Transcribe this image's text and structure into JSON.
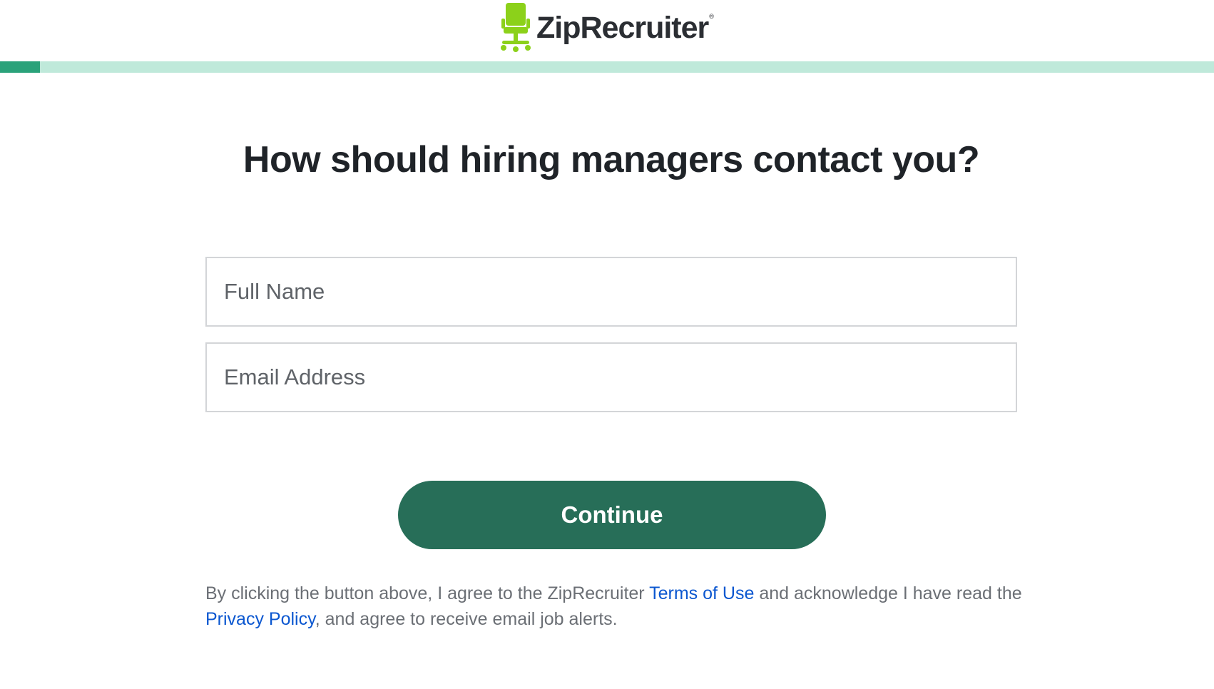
{
  "brand": {
    "name": "ZipRecruiter",
    "registered_mark": "®",
    "logo_icon": "chair-icon",
    "logo_color": "#8cd11a",
    "text_color": "#2b2e33"
  },
  "progress": {
    "fraction": 0.033,
    "fill_color": "#2aa27a",
    "track_color": "#bfe9da"
  },
  "page": {
    "heading": "How should hiring managers contact you?"
  },
  "form": {
    "full_name": {
      "placeholder": "Full Name",
      "value": ""
    },
    "email": {
      "placeholder": "Email Address",
      "value": ""
    },
    "continue_label": "Continue",
    "button_color": "#276e58"
  },
  "legal": {
    "part1": "By clicking the button above, I agree to the ZipRecruiter ",
    "terms_link": "Terms of Use",
    "part2": " and acknowledge I have read the ",
    "privacy_link": "Privacy Policy",
    "part3": ", and agree to receive email job alerts.",
    "link_color": "#0b57d0"
  }
}
